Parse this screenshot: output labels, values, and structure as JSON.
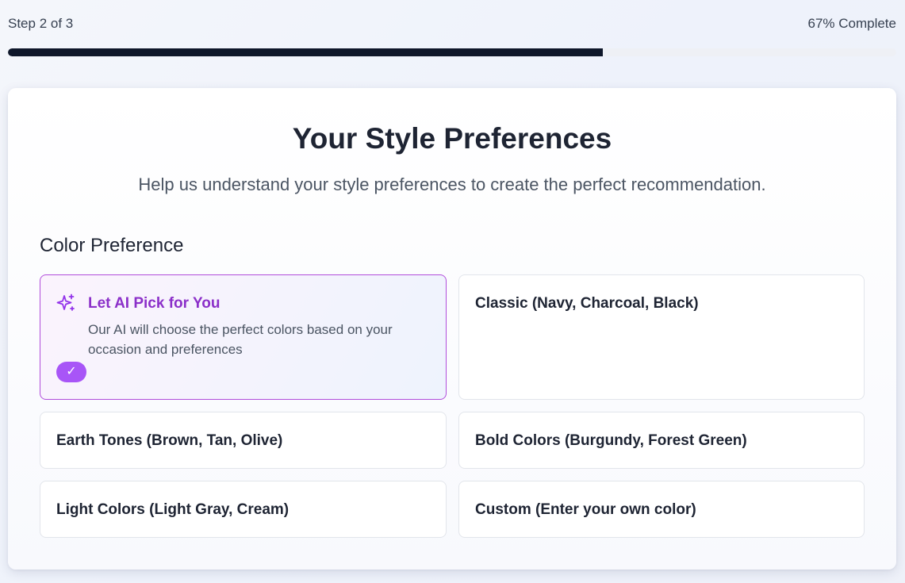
{
  "progress": {
    "step_label": "Step 2 of 3",
    "percent_label": "67% Complete",
    "percent": 67,
    "fill_color": "#0f172a"
  },
  "page": {
    "title": "Your Style Preferences",
    "subtitle": "Help us understand your style preferences to create the perfect recommendation."
  },
  "color_preference": {
    "section_title": "Color Preference",
    "ai_option": {
      "label": "Let AI Pick for You",
      "description": "Our AI will choose the perfect colors based on your occasion and preferences",
      "selected": true,
      "check_mark": "✓",
      "icon": "sparkles-icon",
      "accent_color": "#8b2fc9"
    },
    "options": [
      {
        "label": "Classic (Navy, Charcoal, Black)",
        "selected": false
      },
      {
        "label": "Earth Tones (Brown, Tan, Olive)",
        "selected": false
      },
      {
        "label": "Bold Colors (Burgundy, Forest Green)",
        "selected": false
      },
      {
        "label": "Light Colors (Light Gray, Cream)",
        "selected": false
      },
      {
        "label": "Custom (Enter your own color)",
        "selected": false
      }
    ]
  }
}
